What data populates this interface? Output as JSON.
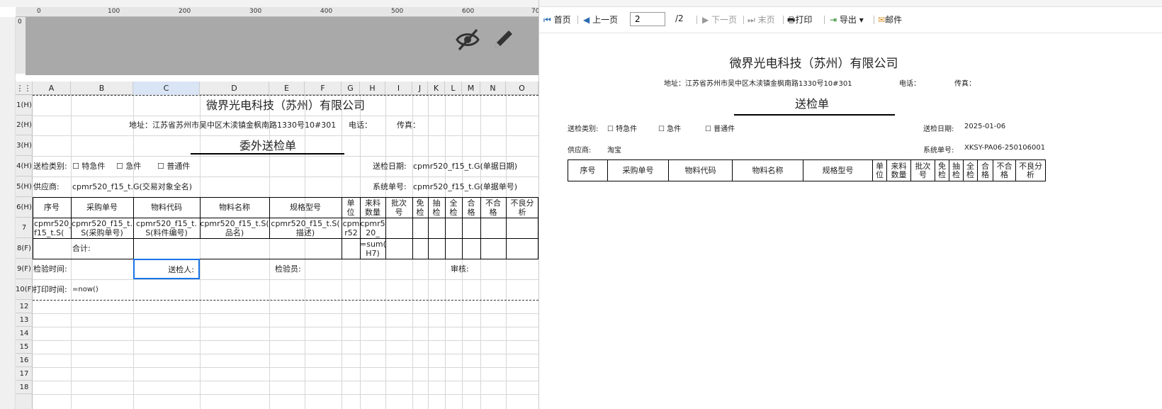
{
  "designer": {
    "ruler_marks": [
      "0",
      "100",
      "200",
      "300",
      "400",
      "500",
      "600",
      "70"
    ],
    "vruler_mark": "0",
    "columns": [
      "A",
      "B",
      "C",
      "D",
      "E",
      "F",
      "G",
      "H",
      "I",
      "J",
      "K",
      "L",
      "M",
      "N",
      "O"
    ],
    "rows": [
      "1(H)",
      "2(H)",
      "3(H)",
      "4(H)",
      "5(H)",
      "6(H)",
      "7",
      "8(F)",
      "9(F)",
      "10(F)",
      "12",
      "13",
      "14",
      "15",
      "16",
      "17",
      "18"
    ],
    "company": "微界光电科技（苏州）有限公司",
    "address": "地址：江苏省苏州市吴中区木渎镇金枫南路1330号10#301",
    "phone": "电话：",
    "fax": "传真：",
    "title": "委外送检单",
    "category_label": "送检类别:",
    "opt_urgent_special": "☐ 特急件",
    "opt_urgent": "☐ 急件",
    "opt_normal": "☐ 普通件",
    "date_label": "送检日期:",
    "date_value": "cpmr520_f15_t.G(单据日期)",
    "supplier_label": "供应商:",
    "supplier_value": "cpmr520_f15_t.G(交易对象全名)",
    "sysno_label": "系统单号:",
    "sysno_value": "cpmr520_f15_t.G(单据单号)",
    "headers": {
      "seq": "序号",
      "po": "采购单号",
      "code": "物料代码",
      "name": "物料名称",
      "spec": "规格型号",
      "unit1": "单",
      "unit2": "位",
      "qty1": "来料",
      "qty2": "数量",
      "batch1": "批次",
      "batch2": "号",
      "exempt1": "免",
      "exempt2": "检",
      "sample1": "抽",
      "sample2": "检",
      "full1": "全",
      "full2": "检",
      "ok1": "合",
      "ok2": "格",
      "ng1": "不合",
      "ng2": "格",
      "anal1": "不良分",
      "anal2": "析"
    },
    "data_row": {
      "seq1": "cpmr520_",
      "seq2": "f15_t.S(",
      "po1": "cpmr520_f15_t.",
      "po2": "S(采购单号)",
      "code1": "cpmr520_f15_t.",
      "code2": "S(料件编号)",
      "name1": "cpmr520_f15_t.S(",
      "name2": "品名)",
      "spec1": "cpmr520_f15_t.S(",
      "spec2": "描述)",
      "unit1": "cpm",
      "unit2": "r52",
      "qty1": "cpmr5",
      "qty2": "20_"
    },
    "total_label": "合计:",
    "sum1": "=sum(",
    "sum2": "H7)",
    "inspect_time": "检验时间:",
    "sender": "送检人:",
    "inspector": "检验员:",
    "reviewer": "审核:",
    "print_time": "打印时间:",
    "now_formula": "=now()"
  },
  "toolbar": {
    "first": "首页",
    "prev": "上一页",
    "page_value": "2",
    "page_total": "/2",
    "next": "下一页",
    "last": "末页",
    "print": "打印",
    "export": "导出",
    "mail": "邮件"
  },
  "preview": {
    "company": "微界光电科技（苏州）有限公司",
    "address": "地址：江苏省苏州市吴中区木渎镇金枫南路1330号10#301",
    "phone": "电话：",
    "fax": "传真：",
    "title": "送检单",
    "category_label": "送检类别:",
    "opt_urgent_special": "☐ 特急件",
    "opt_urgent": "☐ 急件",
    "opt_normal": "☐ 普通件",
    "date_label": "送检日期:",
    "date_value": "2025-01-06",
    "supplier_label": "供应商:",
    "supplier_value": "淘宝",
    "sysno_label": "系统单号:",
    "sysno_value": "XKSY-PA06-250106001",
    "headers": [
      "序号",
      "采购单号",
      "物料代码",
      "物料名称",
      "规格型号",
      "单位",
      "来料数量",
      "批次号",
      "免检",
      "抽检",
      "全检",
      "合格",
      "不合格",
      "不良分析"
    ]
  },
  "colors": {
    "selection": "#1a73e8",
    "header_bg": "#a9a9a9"
  }
}
